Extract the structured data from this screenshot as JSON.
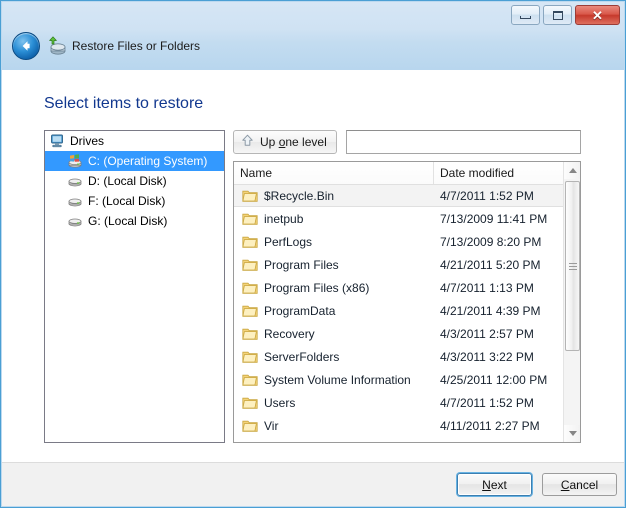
{
  "window": {
    "title": "Restore Files or Folders",
    "title_icon": "restore-files-icon",
    "back_icon": "back-arrow-icon",
    "controls": {
      "minimize": "minimize-icon",
      "maximize": "maximize-icon",
      "close_label": "✕"
    },
    "accent_color": "#4a9fd4",
    "titlebar_color": "#c6dff2"
  },
  "page": {
    "heading": "Select items to restore",
    "heading_color": "#12388f"
  },
  "tree": {
    "root": {
      "label": "Drives",
      "icon": "computer-icon"
    },
    "items": [
      {
        "label": "C: (Operating System)",
        "icon": "windows-drive-icon",
        "selected": true
      },
      {
        "label": "D: (Local Disk)",
        "icon": "drive-icon",
        "selected": false
      },
      {
        "label": "F: (Local Disk)",
        "icon": "drive-icon",
        "selected": false
      },
      {
        "label": "G: (Local Disk)",
        "icon": "drive-icon",
        "selected": false
      }
    ],
    "selection_color": "#3399ff"
  },
  "toolbar": {
    "up_one_level": {
      "pre": "Up ",
      "accel": "o",
      "post": "ne level",
      "icon": "up-arrow-icon"
    },
    "address_value": "",
    "address_placeholder": ""
  },
  "file_list": {
    "columns": [
      "Name",
      "Date modified"
    ],
    "rows": [
      {
        "name": "$Recycle.Bin",
        "date": "4/7/2011 1:52 PM",
        "icon": "folder-icon",
        "selected": true
      },
      {
        "name": "inetpub",
        "date": "7/13/2009 11:41 PM",
        "icon": "folder-icon",
        "selected": false
      },
      {
        "name": "PerfLogs",
        "date": "7/13/2009 8:20 PM",
        "icon": "folder-icon",
        "selected": false
      },
      {
        "name": "Program Files",
        "date": "4/21/2011 5:20 PM",
        "icon": "folder-icon",
        "selected": false
      },
      {
        "name": "Program Files (x86)",
        "date": "4/7/2011 1:13 PM",
        "icon": "folder-icon",
        "selected": false
      },
      {
        "name": "ProgramData",
        "date": "4/21/2011 4:39 PM",
        "icon": "folder-icon",
        "selected": false
      },
      {
        "name": "Recovery",
        "date": "4/3/2011 2:57 PM",
        "icon": "folder-icon",
        "selected": false
      },
      {
        "name": "ServerFolders",
        "date": "4/3/2011 3:22 PM",
        "icon": "folder-icon",
        "selected": false
      },
      {
        "name": "System Volume Information",
        "date": "4/25/2011 12:00 PM",
        "icon": "folder-icon",
        "selected": false
      },
      {
        "name": "Users",
        "date": "4/7/2011 1:52 PM",
        "icon": "folder-icon",
        "selected": false
      },
      {
        "name": "Vir",
        "date": "4/11/2011 2:27 PM",
        "icon": "folder-icon",
        "selected": false
      }
    ],
    "scrollbar": {
      "up_icon": "scroll-up-arrow-icon",
      "down_icon": "scroll-down-arrow-icon"
    }
  },
  "footer": {
    "next": {
      "pre": "",
      "accel": "N",
      "post": "ext"
    },
    "cancel": {
      "pre": "",
      "accel": "C",
      "post": "ancel"
    }
  }
}
